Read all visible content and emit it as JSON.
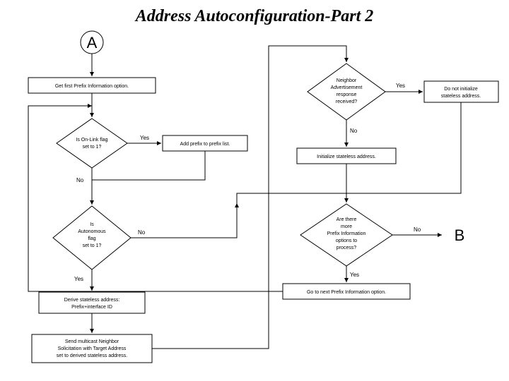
{
  "title": "Address Autoconfiguration-Part 2",
  "connector_top": "A",
  "connector_out": "B",
  "yes": "Yes",
  "no": "No",
  "get_first": "Get first Prefix Information option.",
  "onlink": [
    "Is On-Link flag",
    "set to 1?"
  ],
  "add_prefix": "Add prefix to prefix list.",
  "autonomous": [
    "Is",
    "Autonomous",
    "flag",
    "set to 1?"
  ],
  "derive": [
    "Derive stateless address:",
    "Prefix+interface ID"
  ],
  "send": [
    "Send multicast Neighbor",
    "Solicitation with Target Address",
    "set to derived stateless address."
  ],
  "neighbor": [
    "Neighbor",
    "Advertisement",
    "response",
    "received?"
  ],
  "do_not": [
    "Do not initialize",
    "stateless address."
  ],
  "init": "Initialize stateless address.",
  "more": [
    "Are there",
    "more",
    "Prefix Information",
    "options to",
    "process?"
  ],
  "go_next": "Go to next Prefix Information option."
}
